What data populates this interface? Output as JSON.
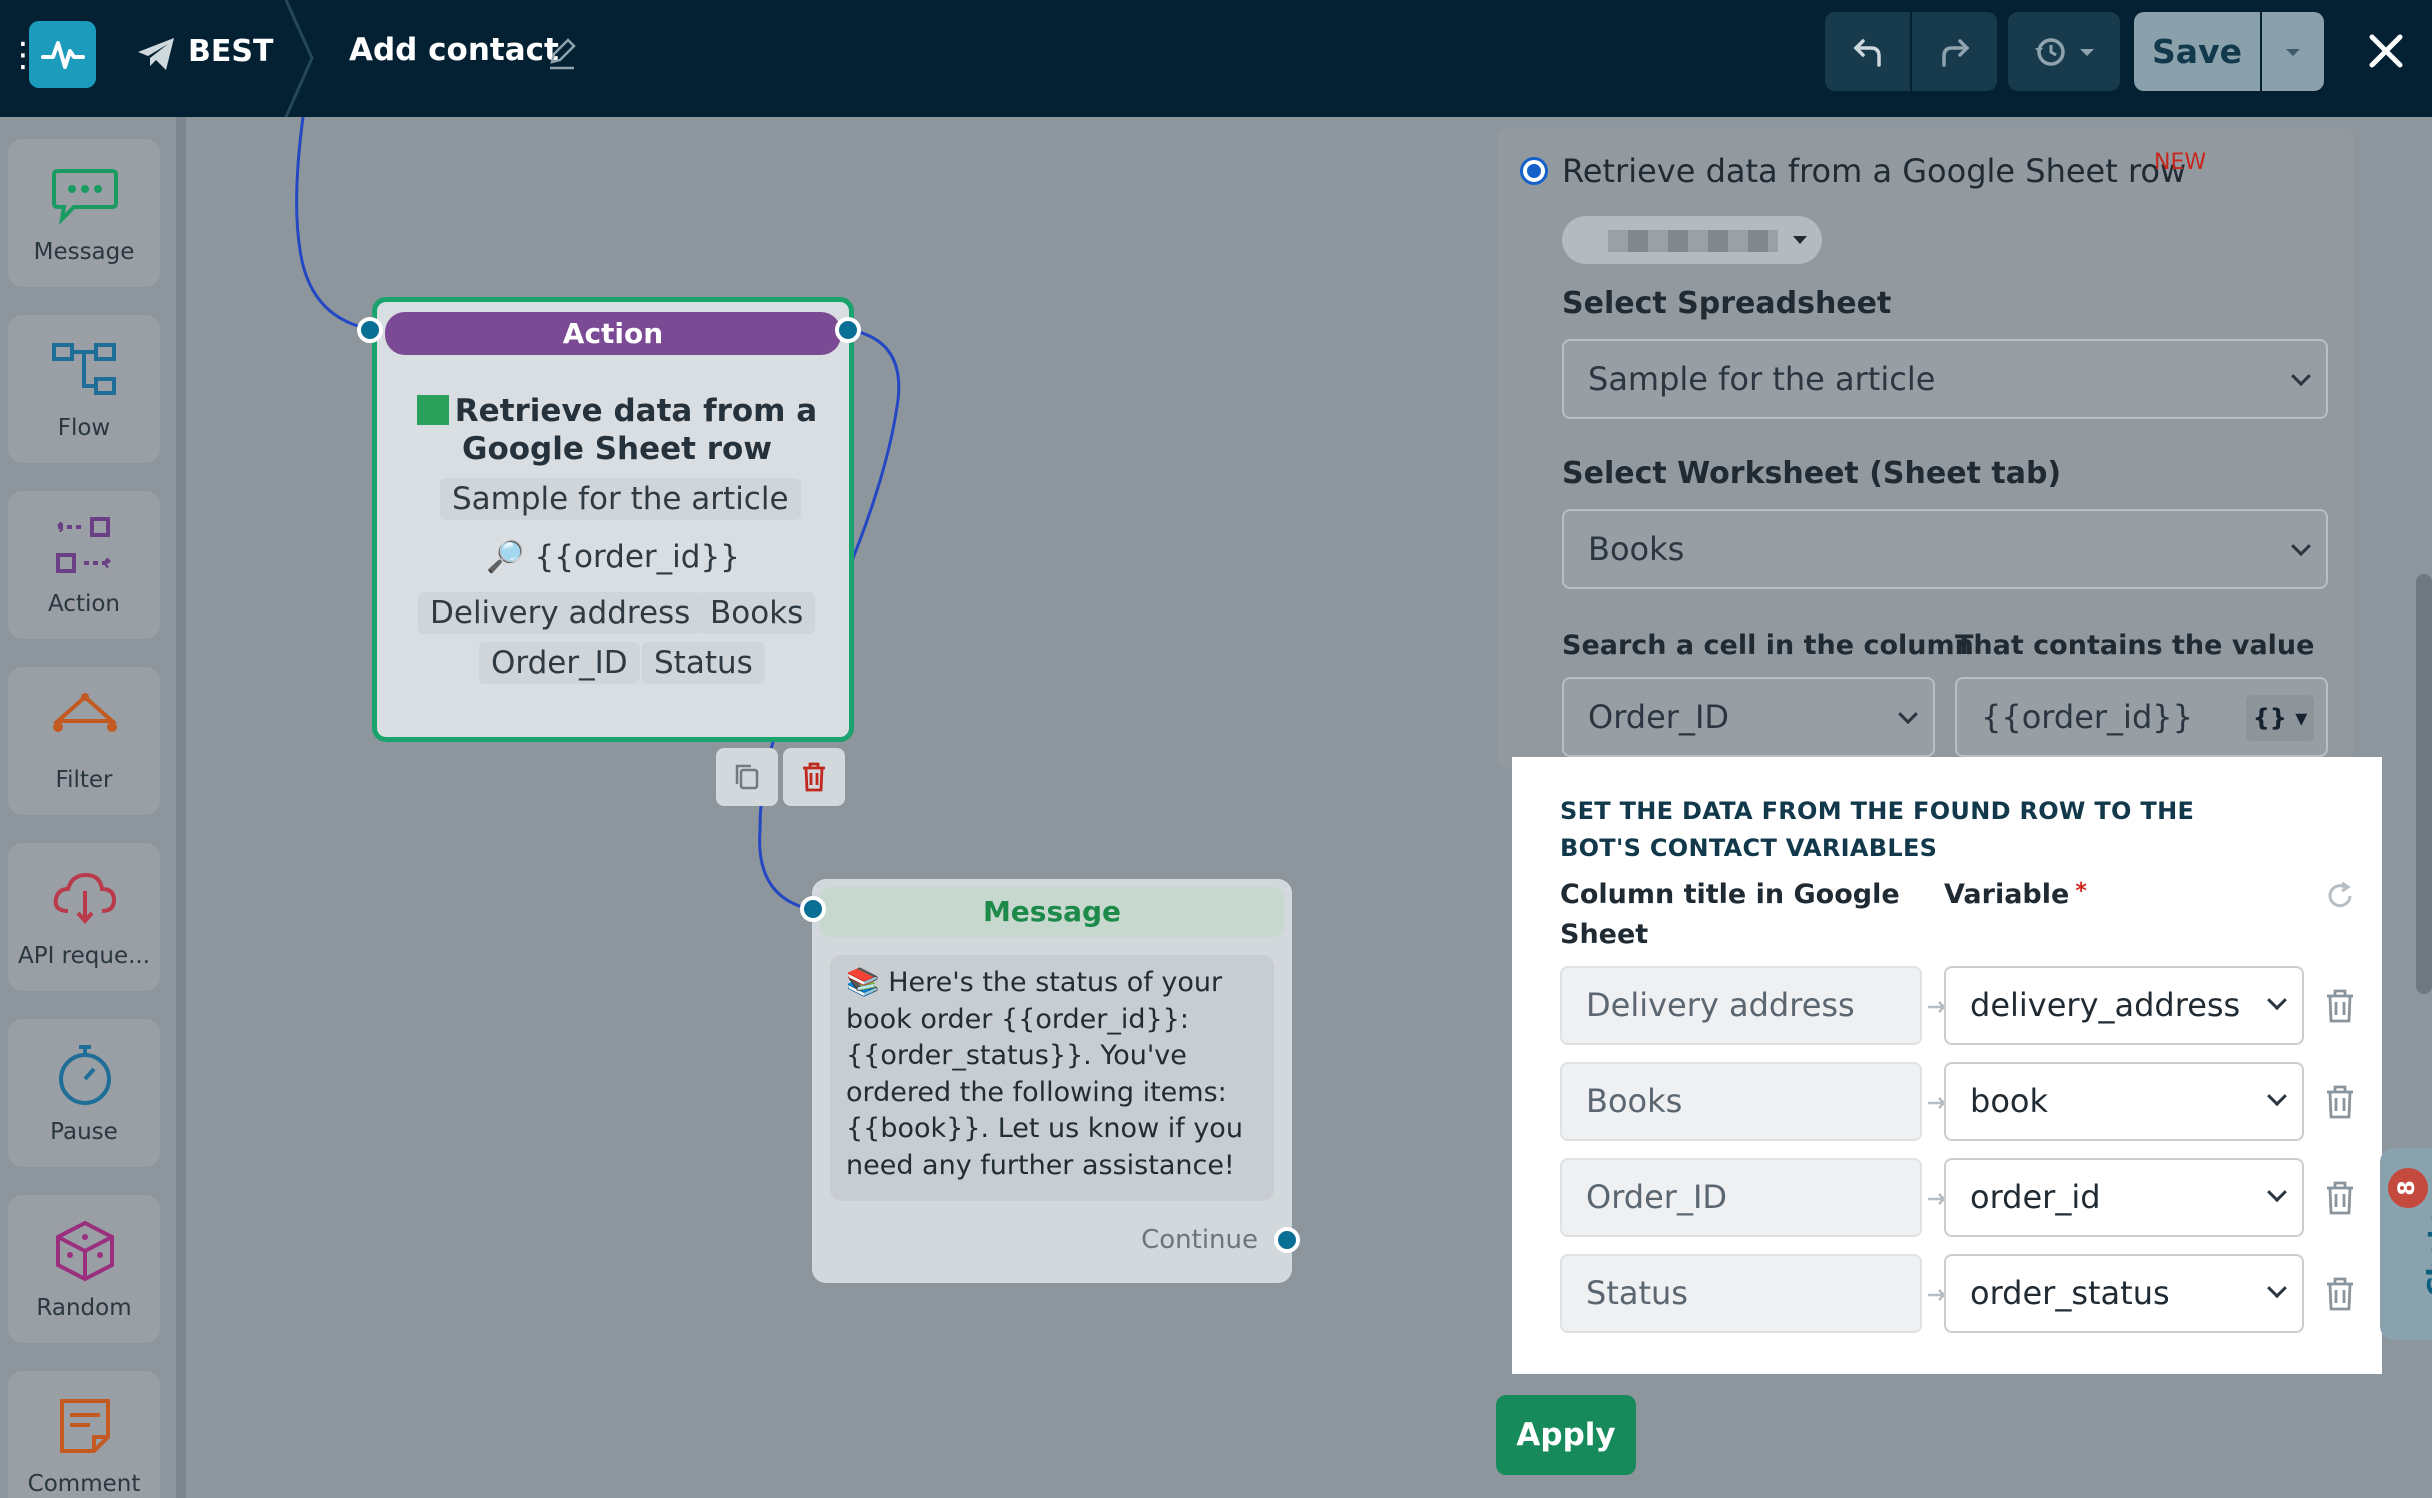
{
  "topbar": {
    "bot_name": "BEST",
    "flow_title": "Add contact",
    "save_label": "Save",
    "icons": [
      "grid-dots-icon",
      "logo-pulse-icon",
      "telegram-plane-icon",
      "edit-pencil-icon",
      "undo-icon",
      "redo-icon",
      "history-icon",
      "chevron-down-icon",
      "close-icon"
    ]
  },
  "tools": [
    {
      "label": "Message",
      "icon": "chat-bubble-icon"
    },
    {
      "label": "Flow",
      "icon": "flow-icon"
    },
    {
      "label": "Action",
      "icon": "action-icon"
    },
    {
      "label": "Filter",
      "icon": "filter-icon"
    },
    {
      "label": "API reque...",
      "icon": "api-cloud-icon"
    },
    {
      "label": "Pause",
      "icon": "stopwatch-icon"
    },
    {
      "label": "Random",
      "icon": "dice-icon"
    },
    {
      "label": "Comment",
      "icon": "comment-icon"
    }
  ],
  "action_node": {
    "header": "Action",
    "title": "Retrieve data from a Google Sheet row",
    "spreadsheet": "Sample for the article",
    "search_value": "{{order_id}}",
    "columns": [
      "Delivery address",
      "Books",
      "Order_ID",
      "Status"
    ]
  },
  "message_node": {
    "header": "Message",
    "text": "Here's the status of your book order {{order_id}}: {{order_status}}. You've ordered the following items: {{book}}. Let us know if you need any further assistance!",
    "continue_label": "Continue"
  },
  "panel": {
    "option_label": "Retrieve data from a Google Sheet row",
    "new_badge": "NEW",
    "spreadsheet_label": "Select Spreadsheet",
    "spreadsheet_value": "Sample for the article",
    "worksheet_label": "Select Worksheet (Sheet tab)",
    "worksheet_value": "Books",
    "search_column_label": "Search a cell in the column",
    "search_column_value": "Order_ID",
    "contains_label": "That contains the value",
    "contains_value": "{{order_id}}",
    "var_tag": "{}",
    "mapping": {
      "title": "SET THE DATA FROM THE FOUND ROW TO THE BOT'S CONTACT VARIABLES",
      "col_header": "Column title in Google Sheet",
      "var_header": "Variable",
      "required_mark": "*",
      "rows": [
        {
          "column": "Delivery address",
          "variable": "delivery_address"
        },
        {
          "column": "Books",
          "variable": "book"
        },
        {
          "column": "Order_ID",
          "variable": "order_id"
        },
        {
          "column": "Status",
          "variable": "order_status"
        }
      ]
    },
    "apply_label": "Apply"
  },
  "chats": {
    "label": "Chats",
    "count": "8"
  },
  "colors": {
    "topbar": "#032133",
    "action_header": "#7b4a94",
    "node_border": "#1aa36c",
    "apply": "#168a5a",
    "accent_blue": "#1560c9"
  }
}
